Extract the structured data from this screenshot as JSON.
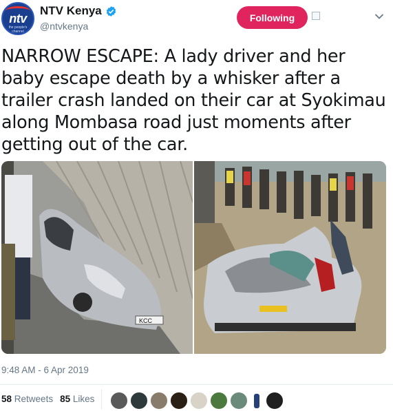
{
  "user": {
    "display_name": "NTV Kenya",
    "handle": "@ntvkenya",
    "avatar_text": "ntv",
    "avatar_sub": "the people's channel",
    "verified": true
  },
  "actions": {
    "follow_label": "Following"
  },
  "tweet": {
    "text": "NARROW ESCAPE: A lady driver and her baby escape death by a whisker after a trailer crash landed on their car at Syokimau along Mombasa road just moments after getting out of the car."
  },
  "media": {
    "left_plate": "KCC"
  },
  "meta": {
    "timestamp": "9:48 AM - 6 Apr 2019"
  },
  "stats": {
    "retweets_count": "58",
    "retweets_label": "Retweets",
    "likes_count": "85",
    "likes_label": "Likes"
  },
  "colors": {
    "follow_button": "#e0245e",
    "verified": "#1da1f2",
    "secondary_text": "#657786"
  },
  "icons": {
    "verified": "verified-badge-icon",
    "chevron": "chevron-down-icon",
    "block": "block-icon"
  }
}
